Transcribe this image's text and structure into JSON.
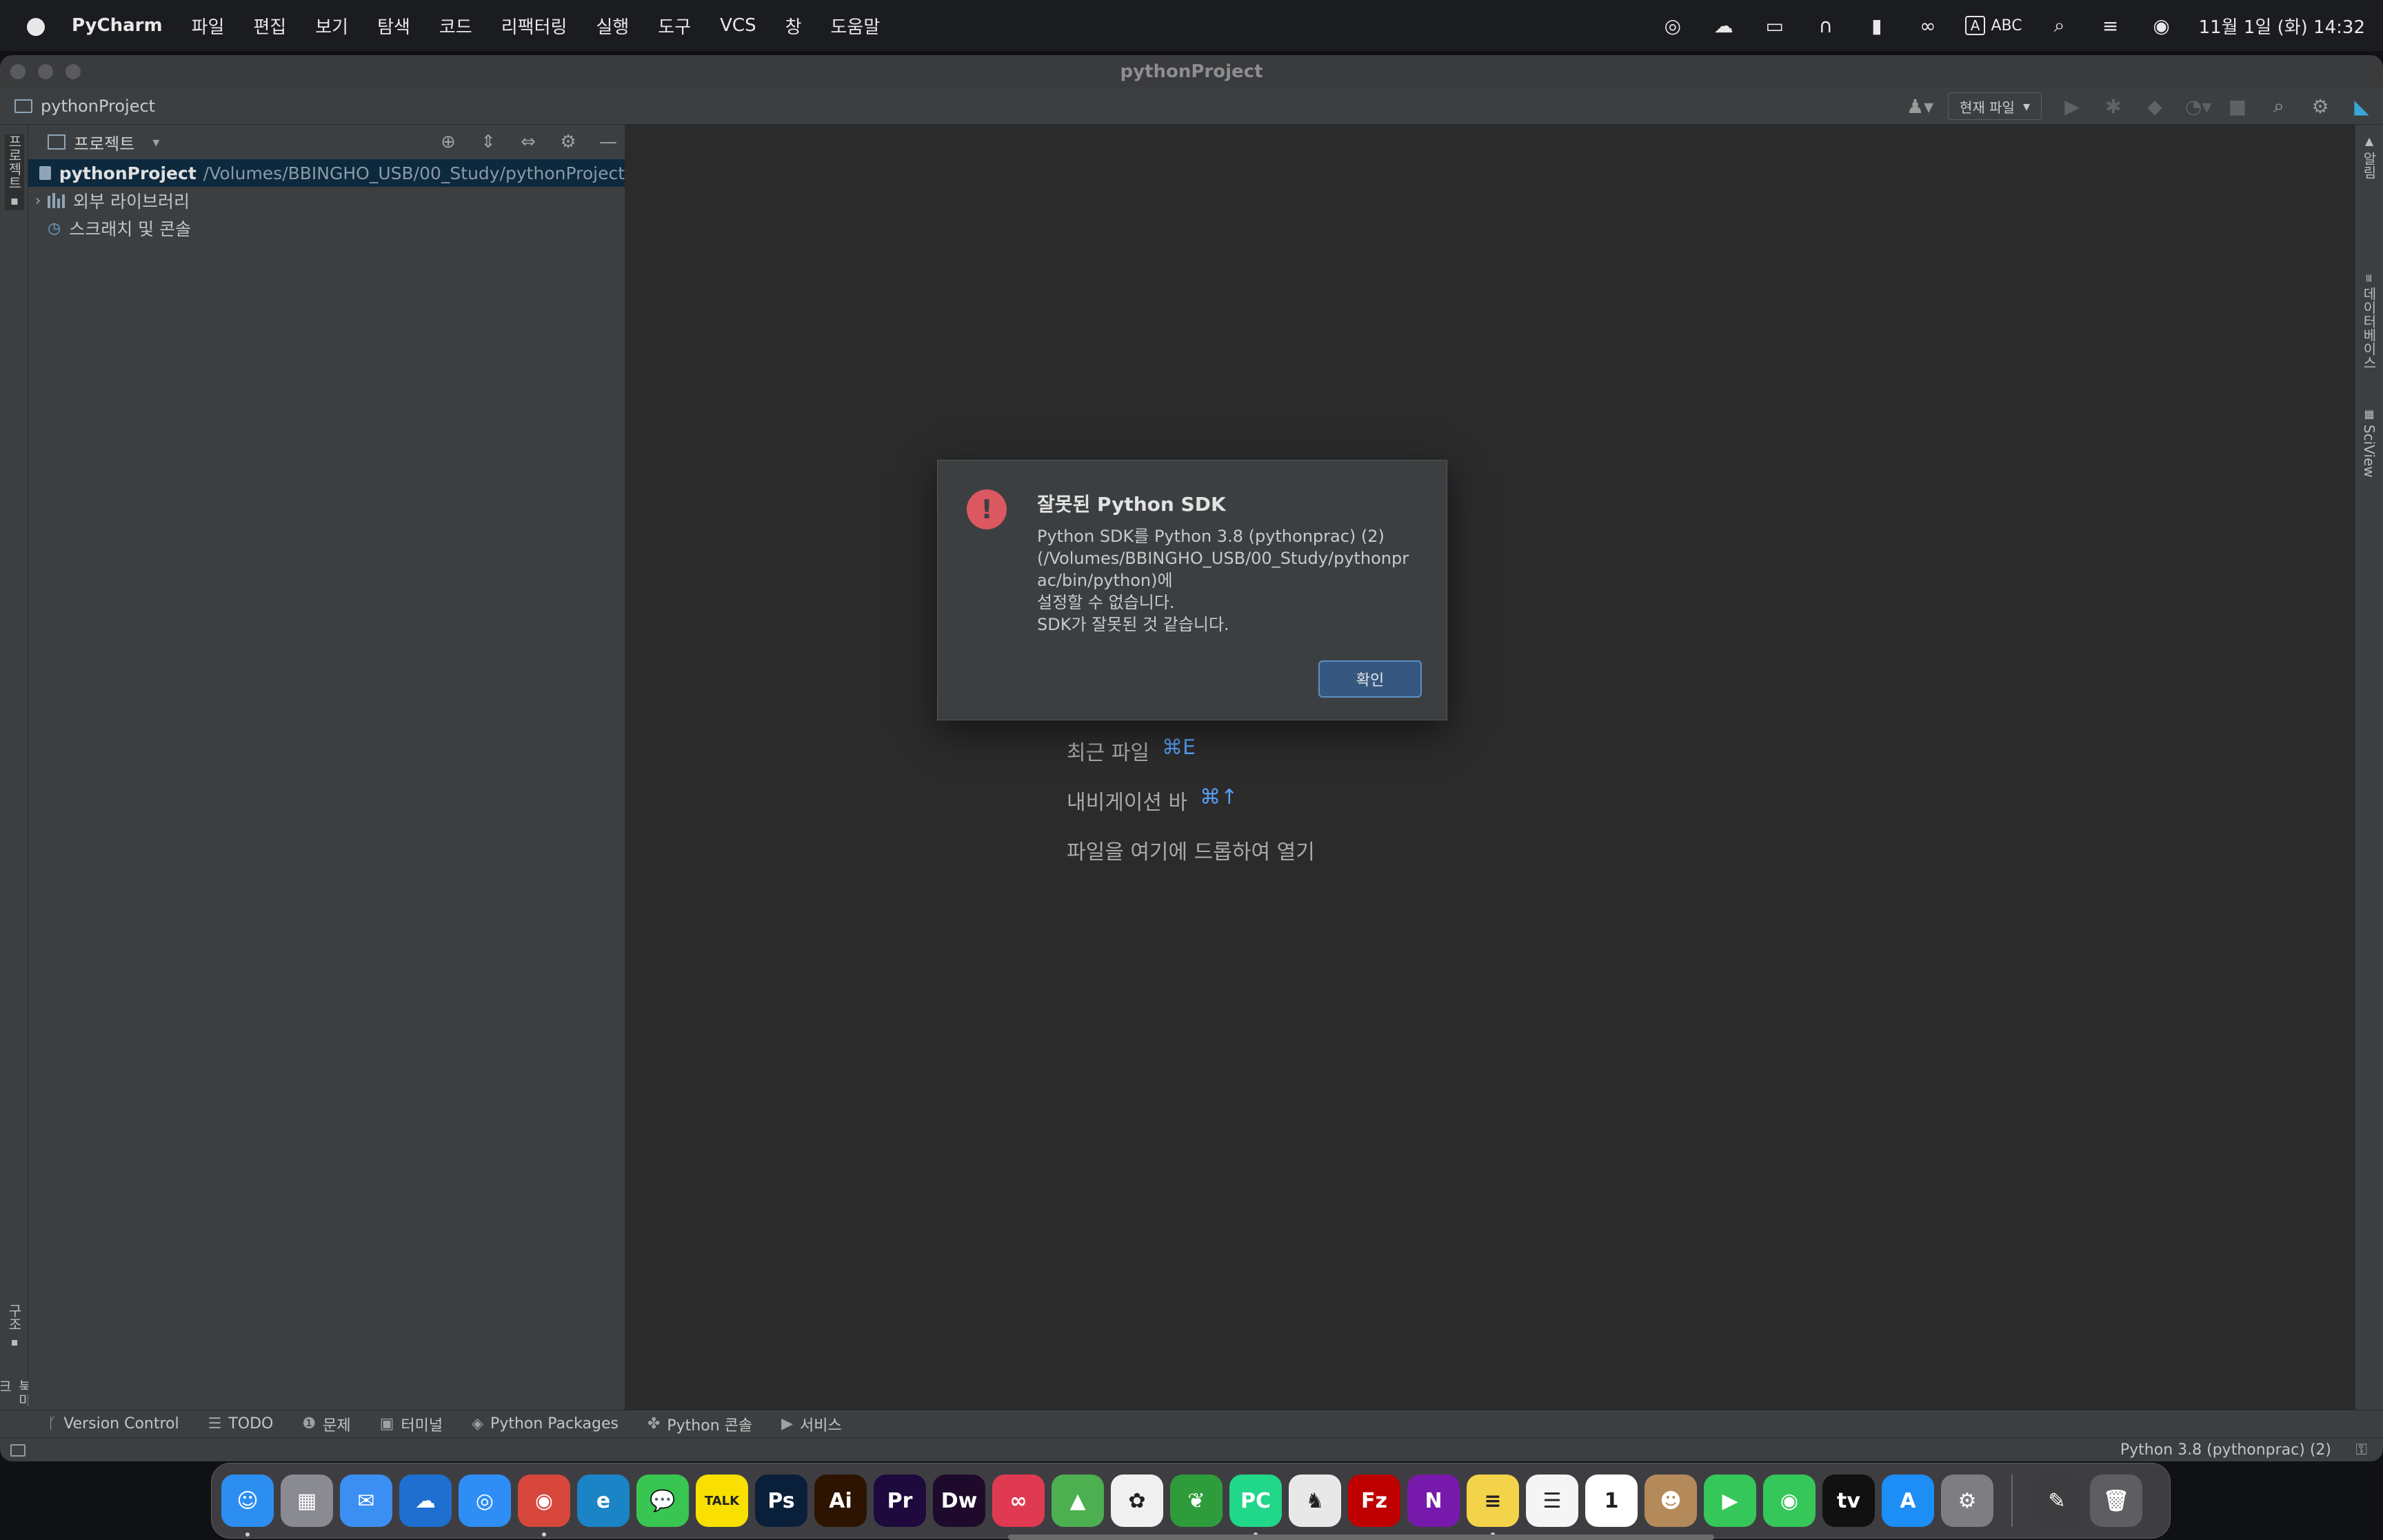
{
  "menubar": {
    "app_name": "PyCharm",
    "items": [
      "파일",
      "편집",
      "보기",
      "탐색",
      "코드",
      "리팩터링",
      "실행",
      "도구",
      "VCS",
      "창",
      "도움말"
    ],
    "input_badge": "A",
    "input_source": "ABC",
    "clock": "11월 1일 (화) 14:32"
  },
  "window": {
    "title": "pythonProject",
    "breadcrumb": "pythonProject",
    "run_config": "현재 파일"
  },
  "left_strip": {
    "project_tab": "프로젝트",
    "structure_tab": "구조",
    "bookmarks_tab": "북마크"
  },
  "right_strip": {
    "notifications_tab": "알림",
    "database_tab": "데이터베이스",
    "sciview_tab": "SciView"
  },
  "project_panel": {
    "title": "프로젝트",
    "root_name": "pythonProject",
    "root_path": "/Volumes/BBINGHO_USB/00_Study/pythonProject",
    "external_libraries": "외부 라이브러리",
    "scratches": "스크래치 및 콘솔"
  },
  "editor": {
    "hints": [
      {
        "label": "최근 파일",
        "key": "⌘E"
      },
      {
        "label": "내비게이션 바",
        "key": "⌘↑"
      },
      {
        "label": "파일을 여기에 드롭하여 열기",
        "key": ""
      }
    ]
  },
  "dialog": {
    "title": "잘못된 Python SDK",
    "message_lines": [
      "Python SDK를 Python 3.8 (pythonprac) (2)",
      "(/Volumes/BBINGHO_USB/00_Study/pythonpr",
      "ac/bin/python)에",
      "설정할 수 없습니다.",
      "SDK가 잘못된 것 같습니다."
    ],
    "ok_label": "확인"
  },
  "bottom_tabs": [
    "Version Control",
    "TODO",
    "문제",
    "터미널",
    "Python Packages",
    "Python 콘솔",
    "서비스"
  ],
  "statusbar": {
    "interpreter": "Python 3.8 (pythonprac) (2)"
  },
  "dock": {
    "items": [
      {
        "name": "finder",
        "text": "☺",
        "color": "#2b8ef0"
      },
      {
        "name": "launchpad",
        "text": "▦",
        "color": "#8a8a92"
      },
      {
        "name": "mail",
        "text": "✉",
        "color": "#3b8ff2"
      },
      {
        "name": "onedrive",
        "text": "☁",
        "color": "#1e6fd0"
      },
      {
        "name": "safari",
        "text": "◎",
        "color": "#2f8ef5"
      },
      {
        "name": "chrome",
        "text": "◉",
        "color": "#d8473b"
      },
      {
        "name": "edge",
        "text": "e",
        "color": "#1a84c6"
      },
      {
        "name": "messages",
        "text": "💬",
        "color": "#39c552"
      },
      {
        "name": "kakaotalk",
        "text": "TALK",
        "color": "#f9e000"
      },
      {
        "name": "photoshop",
        "text": "Ps",
        "color": "#0a1f3a"
      },
      {
        "name": "illustrator",
        "text": "Ai",
        "color": "#2d1400"
      },
      {
        "name": "premiere",
        "text": "Pr",
        "color": "#1e0a3c"
      },
      {
        "name": "dreamweaver",
        "text": "Dw",
        "color": "#1e0a2a"
      },
      {
        "name": "creative-cloud",
        "text": "∞",
        "color": "#e03a52"
      },
      {
        "name": "maps",
        "text": "▲",
        "color": "#4caf50"
      },
      {
        "name": "photos",
        "text": "✿",
        "color": "#f0f0f0"
      },
      {
        "name": "leaf-app",
        "text": "❦",
        "color": "#2e9c3a"
      },
      {
        "name": "pycharm",
        "text": "PC",
        "color": "#21d789"
      },
      {
        "name": "sequel",
        "text": "♞",
        "color": "#e8e8e8"
      },
      {
        "name": "filezilla",
        "text": "Fz",
        "color": "#bf0000"
      },
      {
        "name": "onenote",
        "text": "N",
        "color": "#7719aa"
      },
      {
        "name": "notes",
        "text": "≡",
        "color": "#f3d34a"
      },
      {
        "name": "reminders",
        "text": "☰",
        "color": "#f5f5f5"
      },
      {
        "name": "calendar",
        "text": "1",
        "color": "#ffffff"
      },
      {
        "name": "contacts",
        "text": "☻",
        "color": "#b48a5a"
      },
      {
        "name": "facetime",
        "text": "▶",
        "color": "#35c759"
      },
      {
        "name": "find-my",
        "text": "◉",
        "color": "#35c759"
      },
      {
        "name": "apple-tv",
        "text": "tv",
        "color": "#111111"
      },
      {
        "name": "app-store",
        "text": "A",
        "color": "#1c8ef5"
      },
      {
        "name": "system-settings",
        "text": "⚙",
        "color": "#7d7d82"
      },
      {
        "name": "pen-app",
        "text": "✎",
        "color": "#3d3d40"
      },
      {
        "name": "trash",
        "text": "🗑",
        "color": "#5e5e62"
      }
    ]
  }
}
